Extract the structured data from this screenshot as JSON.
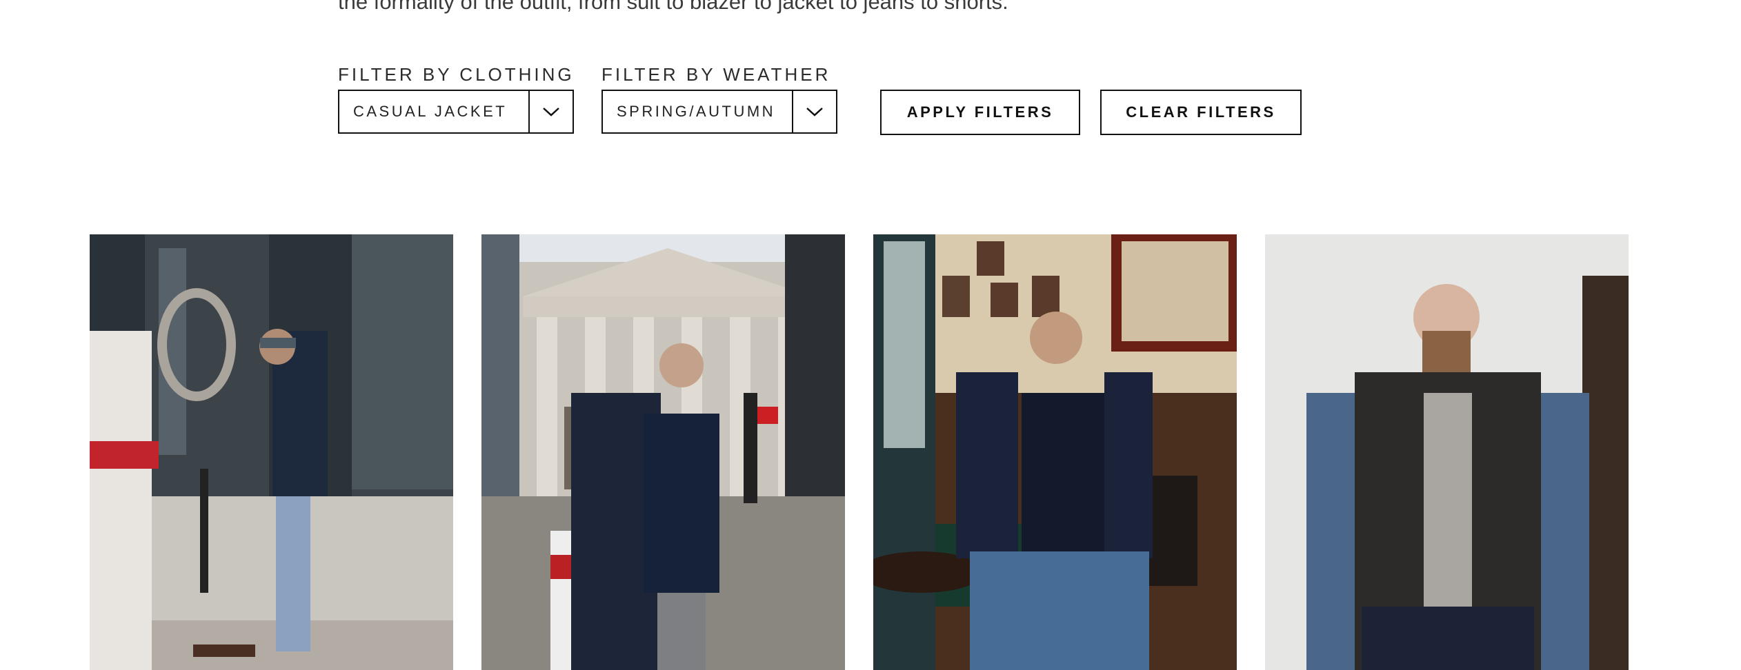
{
  "intro": {
    "text": "the formality of the outfit, from suit to blazer to jacket to jeans to shorts."
  },
  "filters": {
    "clothing": {
      "label": "FILTER BY CLOTHING",
      "selected": "CASUAL JACKET"
    },
    "weather": {
      "label": "FILTER BY WEATHER",
      "selected": "SPRING/AUTUMN"
    }
  },
  "buttons": {
    "apply": "APPLY FILTERS",
    "clear": "CLEAR FILTERS"
  },
  "gallery": {
    "photos": [
      {
        "name": "outfit-photo-street-navy-jacket"
      },
      {
        "name": "outfit-photo-royal-exchange-coat"
      },
      {
        "name": "outfit-photo-pub-suede-jacket"
      },
      {
        "name": "outfit-photo-denim-gilet"
      }
    ]
  },
  "icons": {
    "dropdown": "chevron-down-icon"
  },
  "colors": {
    "border": "#111111",
    "text": "#222222",
    "background": "#ffffff"
  }
}
